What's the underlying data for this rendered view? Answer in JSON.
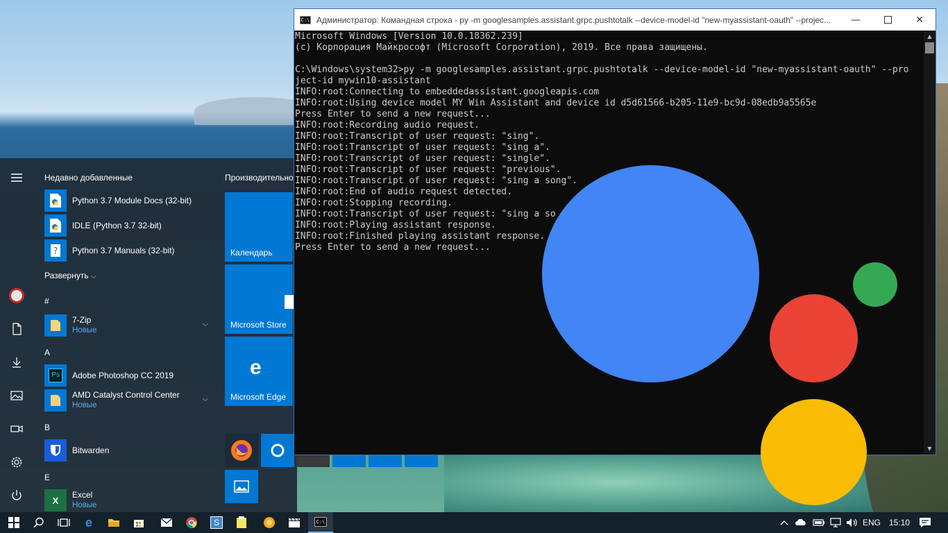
{
  "console": {
    "title": "Администратор: Командная строка - py  -m googlesamples.assistant.grpc.pushtotalk --device-model-id \"new-myassistant-oauth\" --projec...",
    "lines": [
      "Microsoft Windows [Version 10.0.18362.239]",
      "(c) Корпорация Майкрософт (Microsoft Corporation), 2019. Все права защищены.",
      "",
      "C:\\Windows\\system32>py -m googlesamples.assistant.grpc.pushtotalk --device-model-id \"new-myassistant-oauth\" --pro",
      "ject-id mywin10-assistant",
      "INFO:root:Connecting to embeddedassistant.googleapis.com",
      "INFO:root:Using device model MY Win Assistant and device id d5d61566-b205-11e9-bc9d-08edb9a5565e",
      "Press Enter to send a new request...",
      "INFO:root:Recording audio request.",
      "INFO:root:Transcript of user request: \"sing\".",
      "INFO:root:Transcript of user request: \"sing a\".",
      "INFO:root:Transcript of user request: \"single\".",
      "INFO:root:Transcript of user request: \"previous\".",
      "INFO:root:Transcript of user request: \"sing a song\".",
      "INFO:root:End of audio request detected.",
      "INFO:root:Stopping recording.",
      "INFO:root:Transcript of user request: \"sing a so",
      "INFO:root:Playing assistant response.",
      "INFO:root:Finished playing assistant response.",
      "Press Enter to send a new request..."
    ]
  },
  "start_menu": {
    "recent_header": "Недавно добавленные",
    "tiles_header": "Производительно",
    "expand_label": "Развернуть",
    "recent": [
      {
        "name": "Python 3.7 Module Docs (32-bit)",
        "icon": "python-docs-icon"
      },
      {
        "name": "IDLE (Python 3.7 32-bit)",
        "icon": "python-idle-icon"
      },
      {
        "name": "Python 3.7 Manuals (32-bit)",
        "icon": "python-manuals-icon"
      }
    ],
    "groups": [
      {
        "letter": "#",
        "apps": [
          {
            "name": "7-Zip",
            "sub": "Новые",
            "icon": "folder-icon"
          }
        ]
      },
      {
        "letter": "A",
        "apps": [
          {
            "name": "Adobe Photoshop CC 2019",
            "icon": "photoshop-icon",
            "icon_text": "Ps"
          },
          {
            "name": "AMD Catalyst Control Center",
            "sub": "Новые",
            "icon": "folder-icon"
          }
        ]
      },
      {
        "letter": "B",
        "apps": [
          {
            "name": "Bitwarden",
            "icon": "bitwarden-icon"
          }
        ]
      },
      {
        "letter": "E",
        "apps": [
          {
            "name": "Excel",
            "sub": "Новые",
            "icon": "excel-icon",
            "icon_text": "X"
          }
        ]
      }
    ],
    "tiles": [
      {
        "label": "Календарь",
        "icon": "calendar-icon"
      },
      {
        "label": "Microsoft Store",
        "icon": "store-icon"
      },
      {
        "label": "Microsoft Edge",
        "icon": "edge-icon"
      }
    ]
  },
  "taskbar": {
    "lang": "ENG",
    "time": "15:10"
  },
  "colors": {
    "assistant_blue": "#4285f4",
    "assistant_red": "#ea4335",
    "assistant_yellow": "#fbbc05",
    "assistant_green": "#34a853",
    "tile_blue": "#0078d4",
    "new_label": "#63a7e6"
  }
}
